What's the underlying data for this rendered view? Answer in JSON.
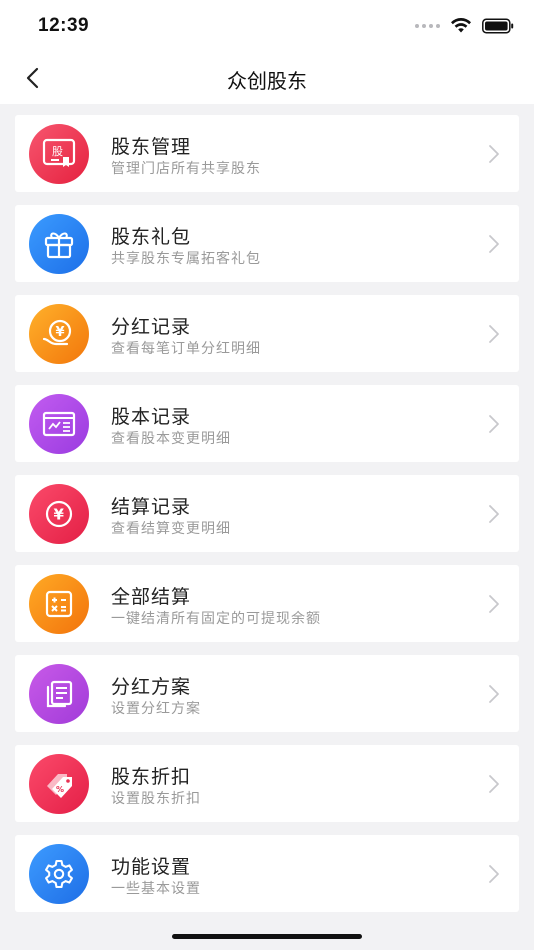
{
  "status": {
    "time": "12:39"
  },
  "nav": {
    "title": "众创股东"
  },
  "menu": [
    {
      "title": "股东管理",
      "subtitle": "管理门店所有共享股东",
      "icon": "shareholder-card-icon",
      "color_from": "#f7566f",
      "color_to": "#e5213f",
      "icon_text": "股"
    },
    {
      "title": "股东礼包",
      "subtitle": "共享股东专属拓客礼包",
      "icon": "gift-icon",
      "color_from": "#3b9bff",
      "color_to": "#1d6fe8"
    },
    {
      "title": "分红记录",
      "subtitle": "查看每笔订单分红明细",
      "icon": "yuan-hand-icon",
      "color_from": "#ffb12b",
      "color_to": "#f2760b",
      "icon_text": "¥"
    },
    {
      "title": "股本记录",
      "subtitle": "查看股本变更明细",
      "icon": "chart-card-icon",
      "color_from": "#c25cf0",
      "color_to": "#9a3be0"
    },
    {
      "title": "结算记录",
      "subtitle": "查看结算变更明细",
      "icon": "yuan-coin-icon",
      "color_from": "#fb4a6a",
      "color_to": "#e31f45",
      "icon_text": "¥"
    },
    {
      "title": "全部结算",
      "subtitle": "一键结清所有固定的可提现余额",
      "icon": "calculator-icon",
      "color_from": "#ffaa25",
      "color_to": "#f2730c"
    },
    {
      "title": "分红方案",
      "subtitle": "设置分红方案",
      "icon": "document-stack-icon",
      "color_from": "#c85ae8",
      "color_to": "#a13bd9"
    },
    {
      "title": "股东折扣",
      "subtitle": "设置股东折扣",
      "icon": "discount-tag-icon",
      "color_from": "#fb4a6a",
      "color_to": "#e41f47",
      "icon_text": "%"
    },
    {
      "title": "功能设置",
      "subtitle": "一些基本设置",
      "icon": "gear-icon",
      "color_from": "#3d9bff",
      "color_to": "#1e6ee6"
    }
  ]
}
